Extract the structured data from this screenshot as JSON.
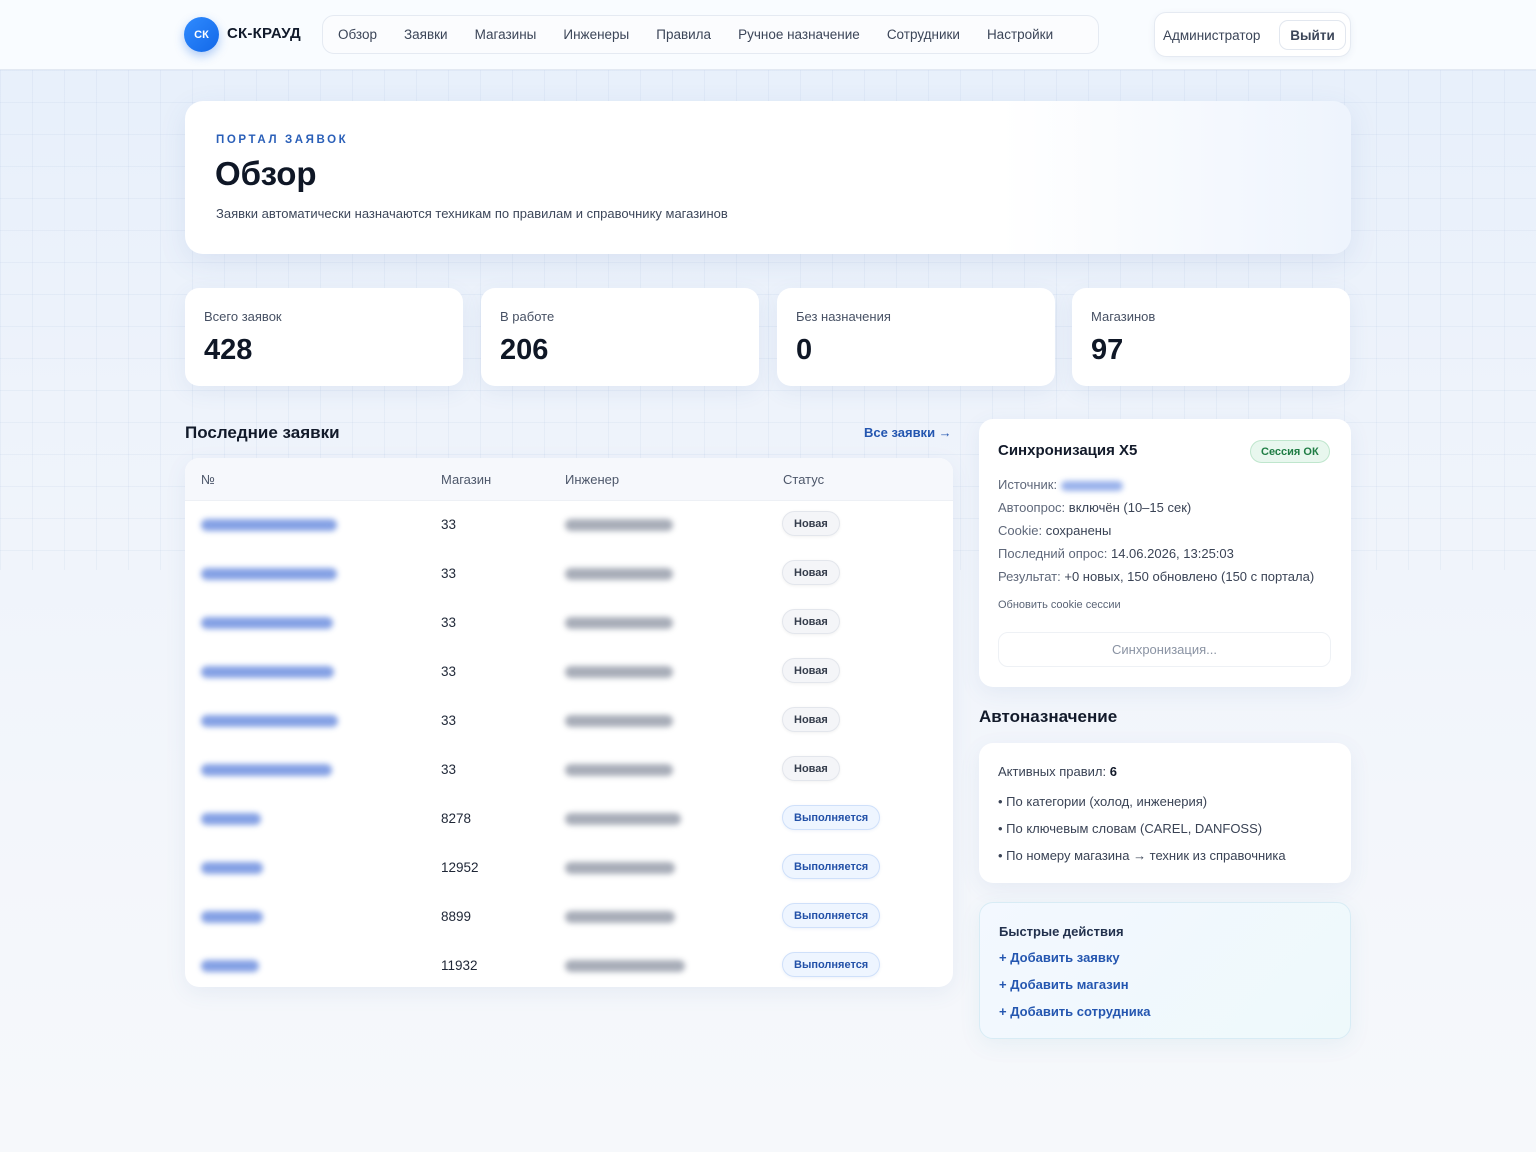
{
  "brand": {
    "logo_text": "СК",
    "name": "СК-КРАУД"
  },
  "nav": [
    "Обзор",
    "Заявки",
    "Магазины",
    "Инженеры",
    "Правила",
    "Ручное назначение",
    "Сотрудники",
    "Настройки"
  ],
  "user": {
    "name": "Администратор",
    "logout_label": "Выйти"
  },
  "hero": {
    "eyebrow": "ПОРТАЛ ЗАЯВОК",
    "title": "Обзор",
    "subtitle": "Заявки автоматически назначаются техникам по правилам и справочнику магазинов"
  },
  "stats": [
    {
      "label": "Всего заявок",
      "value": "428"
    },
    {
      "label": "В работе",
      "value": "206"
    },
    {
      "label": "Без назначения",
      "value": "0"
    },
    {
      "label": "Магазинов",
      "value": "97"
    }
  ],
  "recent": {
    "title": "Последние заявки",
    "all_link": "Все заявки →",
    "columns": [
      "№",
      "Магазин",
      "Инженер",
      "Статус"
    ],
    "rows": [
      {
        "store": "33",
        "status": "Новая",
        "status_kind": "new"
      },
      {
        "store": "33",
        "status": "Новая",
        "status_kind": "new"
      },
      {
        "store": "33",
        "status": "Новая",
        "status_kind": "new"
      },
      {
        "store": "33",
        "status": "Новая",
        "status_kind": "new"
      },
      {
        "store": "33",
        "status": "Новая",
        "status_kind": "new"
      },
      {
        "store": "33",
        "status": "Новая",
        "status_kind": "new"
      },
      {
        "store": "8278",
        "status": "Выполняется",
        "status_kind": "progress"
      },
      {
        "store": "12952",
        "status": "Выполняется",
        "status_kind": "progress"
      },
      {
        "store": "8899",
        "status": "Выполняется",
        "status_kind": "progress"
      },
      {
        "store": "11932",
        "status": "Выполняется",
        "status_kind": "progress"
      }
    ]
  },
  "sync": {
    "title": "Синхронизация Х5",
    "badge": "Сессия ОК",
    "source_label": "Источник:",
    "autopoll_label": "Автоопрос:",
    "autopoll_value": "включён (10–15 сек)",
    "cookie_label": "Cookie:",
    "cookie_value": "сохранены",
    "last_poll_label": "Последний опрос:",
    "last_poll_value": "14.06.2026, 13:25:03",
    "result_label": "Результат:",
    "result_value": "+0 новых, 150 обновлено (150 с портала)",
    "refresh_link": "Обновить cookie сессии",
    "button": "Синхронизация..."
  },
  "auto": {
    "title": "Автоназначение",
    "active_label": "Активных правил:",
    "active_count": "6",
    "rules": [
      "• По категории (холод, инженерия)",
      "• По ключевым словам (CAREL, DANFOSS)",
      "• По номеру магазина → техник из справочника"
    ]
  },
  "quick": {
    "title": "Быстрые действия",
    "actions": [
      "+ Добавить заявку",
      "+ Добавить магазин",
      "+ Добавить сотрудника"
    ]
  }
}
